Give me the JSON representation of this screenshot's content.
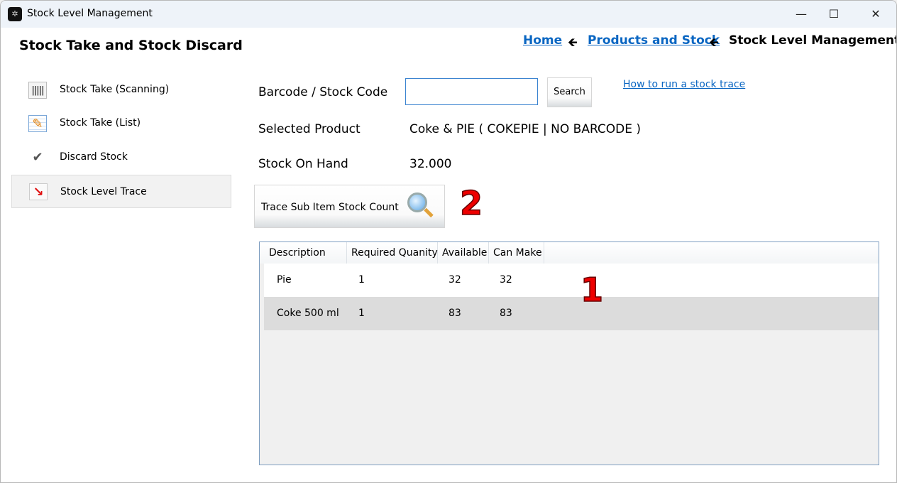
{
  "window": {
    "title": "Stock Level Management"
  },
  "header": {
    "title": "Stock Take and Stock Discard",
    "breadcrumb": [
      "Home",
      "Products and Stock",
      "Stock Level Management"
    ]
  },
  "sidebar": {
    "items": [
      {
        "label": "Stock Take (Scanning)",
        "icon": "barcode-icon"
      },
      {
        "label": "Stock Take (List)",
        "icon": "list-edit-icon"
      },
      {
        "label": "Discard Stock",
        "icon": "discard-icon"
      },
      {
        "label": "Stock Level Trace",
        "icon": "trend-down-icon",
        "selected": true
      }
    ]
  },
  "form": {
    "barcode_label": "Barcode / Stock Code",
    "barcode_value": "",
    "search_label": "Search",
    "help_link": "How to run a stock trace",
    "selected_product_label": "Selected Product",
    "selected_product_value": "Coke & PIE ( COKEPIE | NO BARCODE )",
    "stock_on_hand_label": "Stock On Hand",
    "stock_on_hand_value": "32.000",
    "trace_button": "Trace Sub Item Stock Count"
  },
  "annotations": [
    "1",
    "2"
  ],
  "grid": {
    "columns": [
      "Description",
      "Required Quanity",
      "Available",
      "Can Make"
    ],
    "rows": [
      [
        "Pie",
        "1",
        "32",
        "32"
      ],
      [
        "Coke 500 ml",
        "1",
        "83",
        "83"
      ]
    ]
  }
}
